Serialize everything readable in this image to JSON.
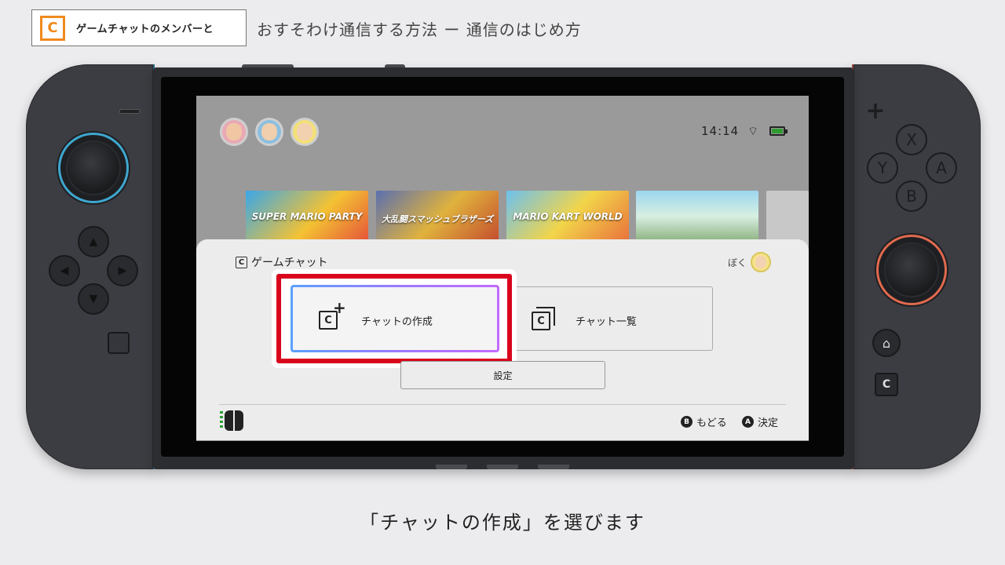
{
  "header": {
    "badge_icon": "C",
    "badge_text": "ゲームチャットのメンバーと",
    "title": "おすそわけ通信する方法 ー 通信のはじめ方"
  },
  "console": {
    "left_joycon_color": "#3fa7cf",
    "right_joycon_color": "#e06a4e",
    "buttons": {
      "x": "X",
      "y": "Y",
      "a": "A",
      "b": "B",
      "plus": "+",
      "home": "⌂",
      "c": "C"
    }
  },
  "screen": {
    "time": "14:14",
    "wifi_icon": "wifi-icon",
    "battery_icon": "battery-charging-icon",
    "avatars": [
      "user-avatar-1",
      "user-avatar-2",
      "user-avatar-3"
    ],
    "games": [
      {
        "label": "SUPER MARIO PARTY"
      },
      {
        "label": "大乱闘スマッシュブラザーズ"
      },
      {
        "label": "MARIO KART WORLD"
      },
      {
        "label": ""
      }
    ]
  },
  "panel": {
    "title_icon": "C",
    "title": "ゲームチャット",
    "user_label": "ぼく",
    "create_chat_label": "チャットの作成",
    "chat_list_label": "チャット一覧",
    "settings_label": "設定",
    "hints": {
      "back_badge": "B",
      "back_label": "もどる",
      "ok_badge": "A",
      "ok_label": "決定"
    },
    "highlight_color": "#d8051c"
  },
  "caption": "「チャットの作成」を選びます"
}
